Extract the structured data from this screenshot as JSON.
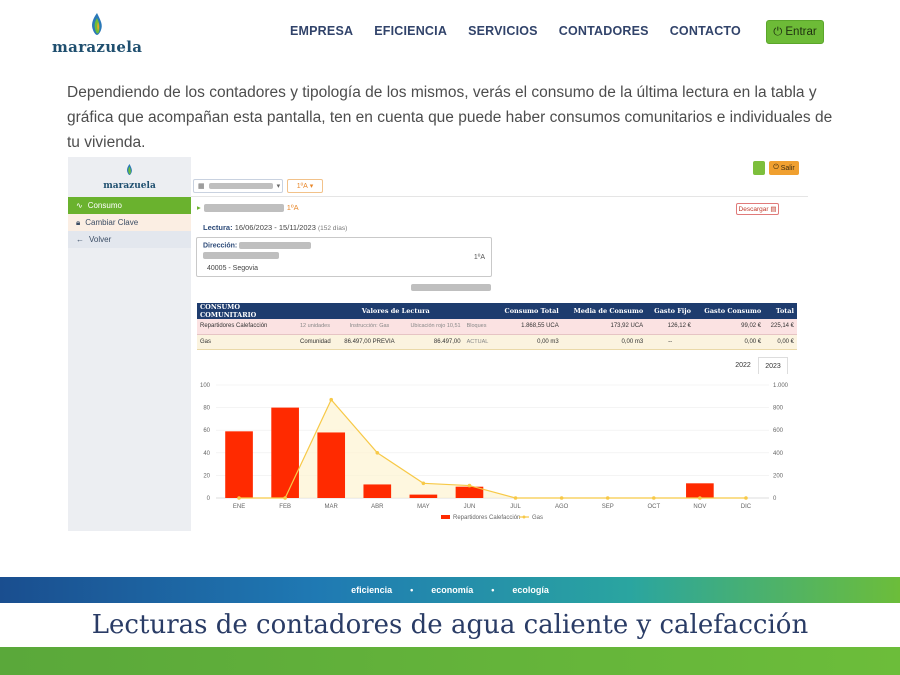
{
  "site": {
    "brand": "marazuela",
    "nav": [
      "EMPRESA",
      "EFICIENCIA",
      "SERVICIOS",
      "CONTADORES",
      "CONTACTO"
    ],
    "login_label": "Entrar",
    "brand_color": "#1f4f6f",
    "accent_green": "#6dbb37"
  },
  "intro_text": "Dependiendo de los contadores y tipología de los mismos, verás el consumo de la última lectura en la tabla y gráfica que acompañan esta pantalla, ten en cuenta que puede haber consumos comunitarios e individuales de tu vivienda.",
  "app": {
    "brand": "marazuela",
    "sidebar": [
      {
        "label": "Consumo",
        "icon": "pulse-icon"
      },
      {
        "label": "Cambiar Clave",
        "icon": "lock-icon"
      },
      {
        "label": "Volver",
        "icon": "arrow-left-icon"
      }
    ],
    "floor_select": "1ºA",
    "salir_label": "Salir",
    "user_floor": "1ºA",
    "download_label": "Descargar",
    "lectura_label": "Lectura:",
    "lectura_range": "16/06/2023 - 15/11/2023",
    "lectura_days": "(152 días)",
    "direccion_label": "Dirección:",
    "direccion_floor": "1ºA",
    "direccion_city": "40005 - Segovia",
    "table": {
      "headers": [
        "CONSUMO COMUNITARIO",
        "Valores de Lectura",
        "Consumo Total",
        "Media de Consumo",
        "Gasto Fijo",
        "Gasto Consumo",
        "Total"
      ],
      "rows": [
        {
          "name": "Repartidores Calefacción",
          "count": "12 unidades",
          "reading_a": "Instrucción: Gas",
          "reading_b": "Ubicación rojo 10,51",
          "reading_b_unit": "Bloques",
          "consumo_total": "1.868,55",
          "consumo_unit": "UCA",
          "media": "173,92",
          "media_unit": "UCA",
          "gasto_fijo": "126,12 €",
          "gasto_consumo": "99,02 €",
          "total": "225,14 €"
        },
        {
          "name": "Gas",
          "count": "Comunidad",
          "reading_a": "86.497,00",
          "reading_a_unit": "PREVIA",
          "reading_b": "86.497,00",
          "reading_b_unit": "ACTUAL",
          "consumo_total": "0,00",
          "consumo_unit": "m3",
          "media": "0,00",
          "media_unit": "m3",
          "gasto_fijo": "--",
          "gasto_consumo": "0,00 €",
          "total": "0,00 €"
        }
      ]
    },
    "year_tabs": [
      "2022",
      "2023"
    ],
    "active_year": "2023"
  },
  "chart_data": {
    "type": "bar",
    "categories": [
      "ENE",
      "FEB",
      "MAR",
      "ABR",
      "MAY",
      "JUN",
      "JUL",
      "AGO",
      "SEP",
      "OCT",
      "NOV",
      "DIC"
    ],
    "series": [
      {
        "name": "Repartidores Calefacción",
        "type": "bar",
        "axis": "left",
        "color": "#ff2a00",
        "values": [
          59,
          80,
          58,
          12,
          3,
          10,
          0,
          0,
          0,
          0,
          13,
          0
        ]
      },
      {
        "name": "Gas",
        "type": "line",
        "axis": "right",
        "color": "#f7c948",
        "values": [
          0,
          0,
          870,
          400,
          130,
          110,
          0,
          0,
          0,
          0,
          0,
          0
        ]
      }
    ],
    "y_left": {
      "min": 0,
      "max": 100,
      "ticks": [
        "0",
        "20",
        "40",
        "60",
        "80",
        "100"
      ]
    },
    "y_right": {
      "min": 0,
      "max": 1000,
      "ticks": [
        "0",
        "200",
        "400",
        "600",
        "800",
        "1.000"
      ]
    },
    "grid": true,
    "legend": "bottom"
  },
  "banner": {
    "tags": [
      "eficiencia",
      "economía",
      "ecología"
    ],
    "title": "Lecturas de contadores de agua caliente y calefacción"
  }
}
